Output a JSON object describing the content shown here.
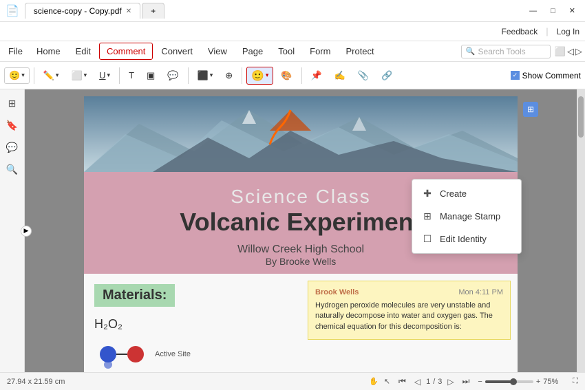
{
  "titlebar": {
    "app_icon": "📄",
    "tab_title": "science-copy - Copy.pdf",
    "new_tab_label": "+",
    "feedback_label": "Feedback",
    "login_label": "Log In",
    "win_minimize": "—",
    "win_maximize": "□",
    "win_close": "✕"
  },
  "menubar": {
    "file_label": "File",
    "items": [
      "Home",
      "Edit",
      "Comment",
      "Convert",
      "View",
      "Page",
      "Tool",
      "Form",
      "Protect"
    ],
    "active_item": "Comment",
    "search_placeholder": "Search Tools"
  },
  "toolbar": {
    "show_comment_label": "Show Comment",
    "tools": [
      "stamp-group",
      "annotation",
      "eraser",
      "underline",
      "text",
      "textbox",
      "stamp",
      "area",
      "connector",
      "pin",
      "signature",
      "attachment",
      "linker"
    ]
  },
  "dropdown": {
    "items": [
      {
        "label": "Create",
        "icon": "+"
      },
      {
        "label": "Manage Stamp",
        "icon": "⊞"
      },
      {
        "label": "Edit Identity",
        "icon": "☐"
      }
    ]
  },
  "pdf": {
    "title_line1": "Science Class",
    "title_line2": "Volcanic Experiment",
    "school": "Willow Creek High School",
    "byline": "By Brooke Wells",
    "materials_label": "Materials:",
    "formula_label": "H₂O₂",
    "active_site_label": "Active Site",
    "comment": {
      "author": "Brook Wells",
      "time": "Mon 4:11 PM",
      "text": "Hydrogen peroxide molecules are very unstable and naturally decompose into water and oxygen gas. The chemical equation for this decomposition is:"
    }
  },
  "statusbar": {
    "dimensions": "27.94 x 21.59 cm",
    "hand_icon": "✋",
    "select_icon": "↖",
    "page_current": "1",
    "page_total": "3",
    "zoom_level": "75%",
    "zoom_minus": "−",
    "zoom_plus": "+"
  }
}
